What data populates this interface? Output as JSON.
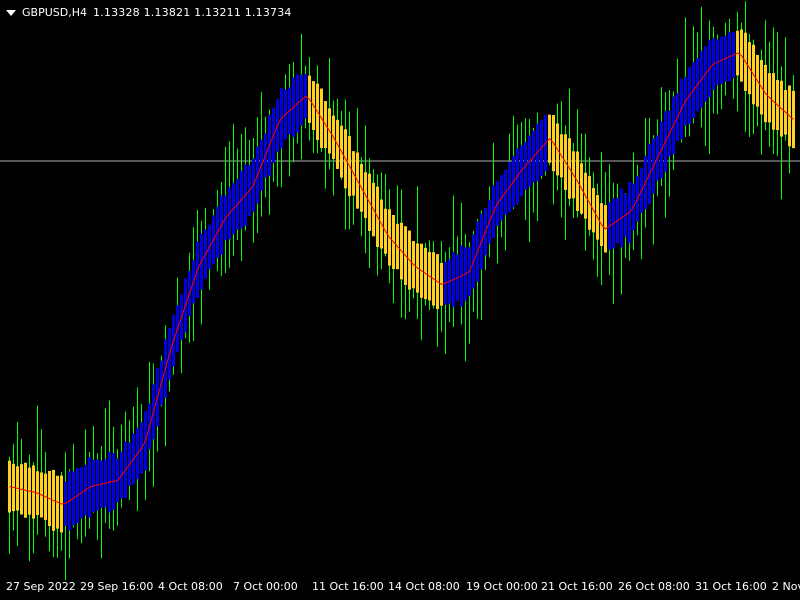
{
  "header": {
    "symbol": "GBPUSD,H4",
    "ohlc": "1.13328 1.13821 1.13211 1.13734"
  },
  "colors": {
    "background": "#000000",
    "candle_up": "#00ff00",
    "bear_band": "#ffd21f",
    "bull_band": "#0000e0",
    "midline": "#ff0000",
    "price_line": "#b0b0b0",
    "text": "#ffffff"
  },
  "xaxis": {
    "labels": [
      "27 Sep 2022",
      "29 Sep 16:00",
      "4 Oct 08:00",
      "7 Oct 00:00",
      "11 Oct 16:00",
      "14 Oct 08:00",
      "19 Oct 00:00",
      "21 Oct 16:00",
      "26 Oct 08:00",
      "31 Oct 16:00",
      "2 Nov"
    ]
  },
  "chart_data": {
    "type": "line",
    "series": [
      {
        "values": [
          1.072,
          1.071,
          1.069,
          1.072,
          1.073,
          1.079,
          1.095,
          1.108,
          1.116,
          1.121,
          1.132,
          1.136,
          1.129,
          1.121,
          1.113,
          1.108,
          1.105,
          1.107,
          1.118,
          1.124,
          1.129,
          1.122,
          1.114,
          1.117,
          1.126,
          1.135,
          1.141,
          1.143,
          1.136,
          1.132
        ]
      }
    ]
  }
}
